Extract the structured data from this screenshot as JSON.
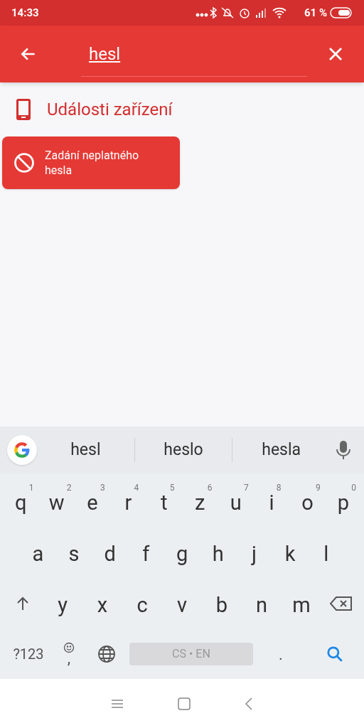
{
  "status_bar": {
    "time": "14:33",
    "battery": "61 %"
  },
  "search": {
    "value": "hesl"
  },
  "section": {
    "title": "Události zařízení"
  },
  "results": [
    {
      "label": "Zadání neplatného hesla"
    }
  ],
  "keyboard": {
    "suggestions": [
      "hesl",
      "heslo",
      "hesla"
    ],
    "rows": [
      [
        {
          "key": "q",
          "hint": "1"
        },
        {
          "key": "w",
          "hint": "2"
        },
        {
          "key": "e",
          "hint": "3"
        },
        {
          "key": "r",
          "hint": "4"
        },
        {
          "key": "t",
          "hint": "5"
        },
        {
          "key": "z",
          "hint": "6"
        },
        {
          "key": "u",
          "hint": "7"
        },
        {
          "key": "i",
          "hint": "8"
        },
        {
          "key": "o",
          "hint": "9"
        },
        {
          "key": "p",
          "hint": "0"
        }
      ],
      [
        {
          "key": "a"
        },
        {
          "key": "s"
        },
        {
          "key": "d"
        },
        {
          "key": "f"
        },
        {
          "key": "g"
        },
        {
          "key": "h"
        },
        {
          "key": "j"
        },
        {
          "key": "k"
        },
        {
          "key": "l"
        }
      ],
      [
        {
          "kind": "shift"
        },
        {
          "key": "y"
        },
        {
          "key": "x"
        },
        {
          "key": "c"
        },
        {
          "key": "v"
        },
        {
          "key": "b"
        },
        {
          "key": "n"
        },
        {
          "key": "m"
        },
        {
          "kind": "backspace"
        }
      ]
    ],
    "bottom": {
      "symbols": "?123",
      "comma": ",",
      "space": "CS • EN",
      "period": "."
    }
  }
}
